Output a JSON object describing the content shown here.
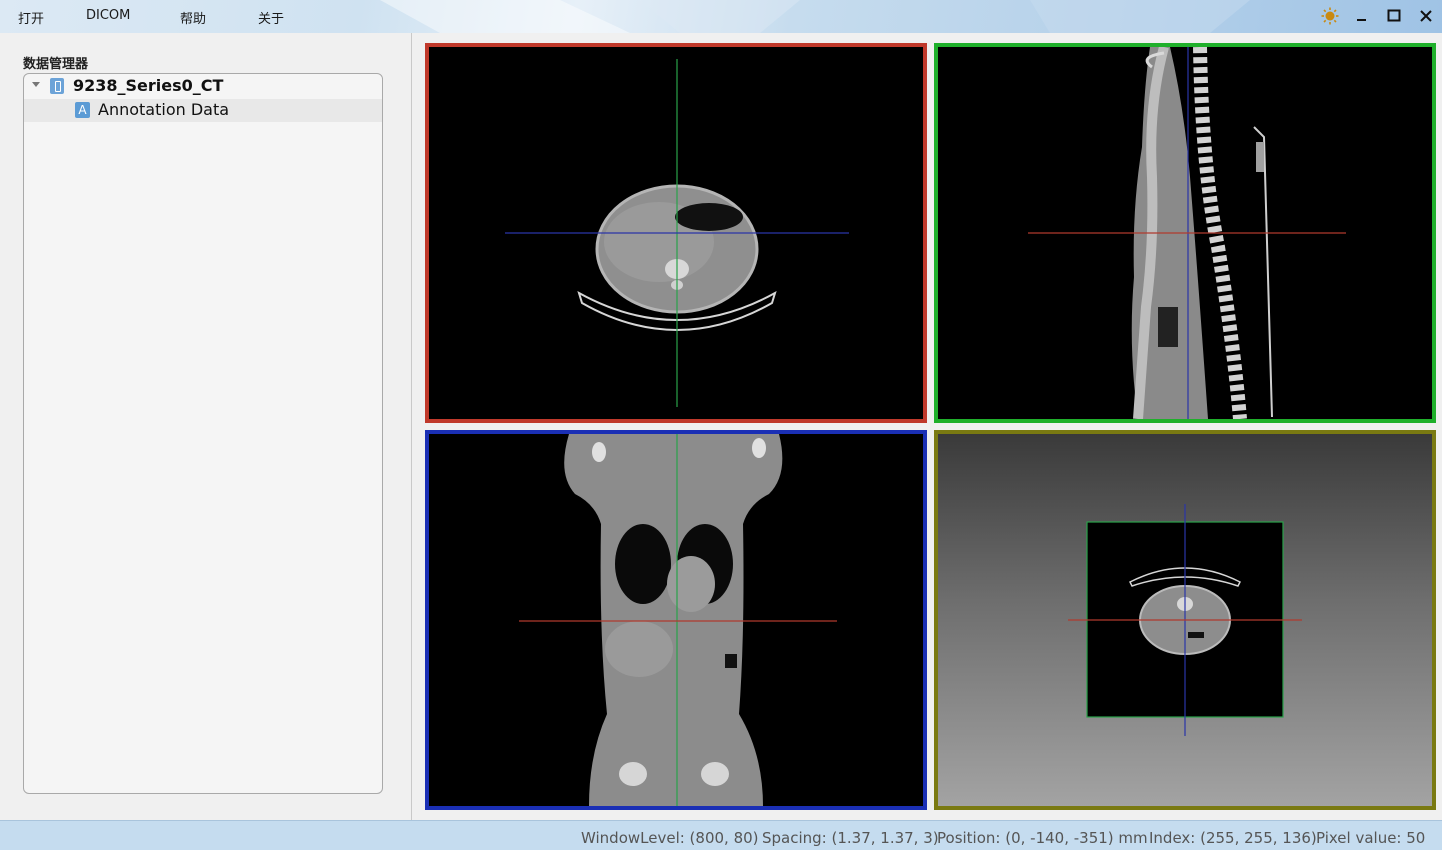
{
  "menu": {
    "items": [
      "打开",
      "DICOM",
      "帮助",
      "关于"
    ]
  },
  "window_controls": {
    "theme": "sun-icon",
    "minimize": "minimize-icon",
    "maximize": "maximize-icon",
    "close": "close-icon"
  },
  "left_panel": {
    "title": "数据管理器",
    "tree": {
      "series": {
        "label": "9238_Series0_CT",
        "expanded": true
      },
      "children": [
        {
          "icon_letter": "A",
          "label": "Annotation Data"
        }
      ]
    }
  },
  "viewports": [
    {
      "name": "axial",
      "frame_color": "#c0392b"
    },
    {
      "name": "sagittal",
      "frame_color": "#1fb02b"
    },
    {
      "name": "coronal",
      "frame_color": "#1a2fb5"
    },
    {
      "name": "3d",
      "frame_color": "#7a7a12"
    }
  ],
  "status": {
    "window_level": "WindowLevel: (800, 80)",
    "spacing": "Spacing: (1.37, 1.37, 3)",
    "position": "Position: (0, -140, -351) mm",
    "index": "Index: (255, 255, 136)",
    "pixel_value": "Pixel value: 50"
  }
}
